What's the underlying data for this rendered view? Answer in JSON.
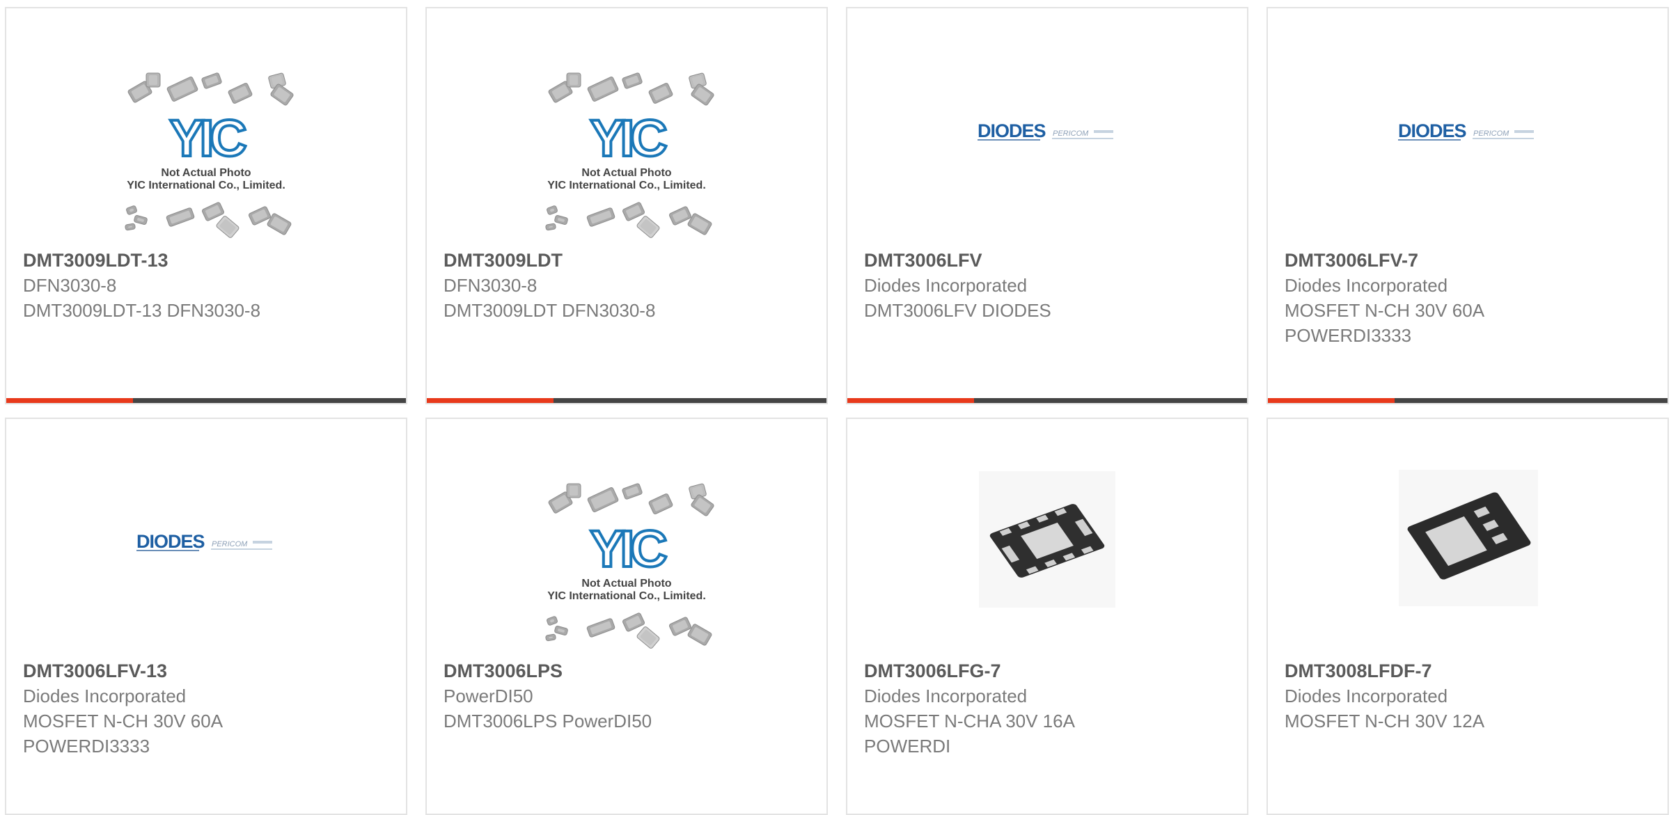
{
  "colors": {
    "accent": "#e8391b",
    "bar": "#444444",
    "title": "#5a5a5a",
    "text": "#7a7a7a",
    "border": "#e3e3e3"
  },
  "placeholder_photo": {
    "brand": "YIC",
    "line1": "Not Actual Photo",
    "line2": "YIC International Co., Limited."
  },
  "diodes_logo": {
    "brand": "DIODES",
    "partner": "PERICOM"
  },
  "products": [
    {
      "part_number": "DMT3009LDT-13",
      "subtitle": "DFN3030-8",
      "description": "DMT3009LDT-13 DFN3030-8",
      "image": "yic-placeholder-icon"
    },
    {
      "part_number": "DMT3009LDT",
      "subtitle": "DFN3030-8",
      "description": "DMT3009LDT DFN3030-8",
      "image": "yic-placeholder-icon"
    },
    {
      "part_number": "DMT3006LFV",
      "subtitle": "Diodes Incorporated",
      "description": "DMT3006LFV DIODES",
      "image": "diodes-logo-icon"
    },
    {
      "part_number": "DMT3006LFV-7",
      "subtitle": "Diodes Incorporated",
      "description": "MOSFET N-CH 30V 60A POWERDI3333",
      "image": "diodes-logo-icon"
    },
    {
      "part_number": "DMT3006LFV-13",
      "subtitle": "Diodes Incorporated",
      "description": "MOSFET N-CH 30V 60A POWERDI3333",
      "image": "diodes-logo-icon"
    },
    {
      "part_number": "DMT3006LPS",
      "subtitle": "PowerDI50",
      "description": "DMT3006LPS PowerDI50",
      "image": "yic-placeholder-icon"
    },
    {
      "part_number": "DMT3006LFG-7",
      "subtitle": "Diodes Incorporated",
      "description": "MOSFET N-CHA 30V 16A POWERDI",
      "image": "chip-package-icon"
    },
    {
      "part_number": "DMT3008LFDF-7",
      "subtitle": "Diodes Incorporated",
      "description": "MOSFET N-CH 30V 12A",
      "image": "chip-package-small-icon"
    }
  ]
}
